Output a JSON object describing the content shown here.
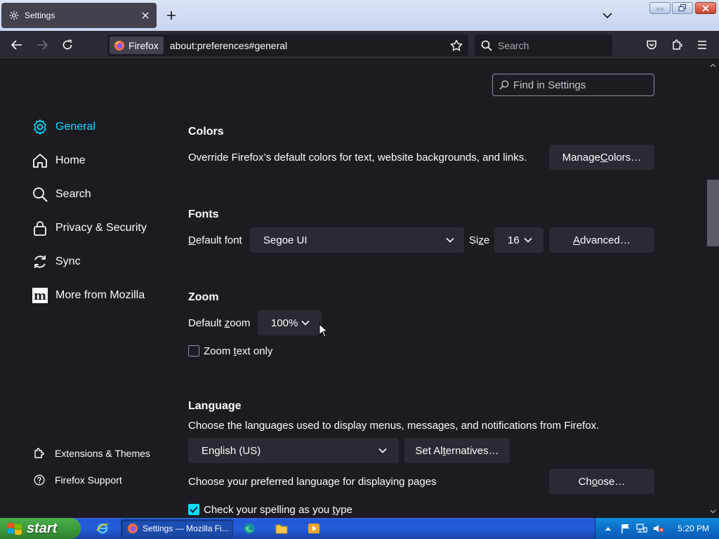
{
  "window": {
    "tab_title": "Settings",
    "url": "about:preferences#general",
    "identity_label": "Firefox",
    "search_placeholder": "Search"
  },
  "find": {
    "placeholder": "Find in Settings"
  },
  "sidebar": {
    "items": [
      {
        "label": "General",
        "icon": "gear-icon",
        "active": true
      },
      {
        "label": "Home",
        "icon": "home-icon"
      },
      {
        "label": "Search",
        "icon": "search-icon"
      },
      {
        "label": "Privacy & Security",
        "icon": "lock-icon"
      },
      {
        "label": "Sync",
        "icon": "sync-icon"
      },
      {
        "label": "More from Mozilla",
        "icon": "mozilla-icon"
      }
    ],
    "footer": [
      {
        "label": "Extensions & Themes",
        "icon": "puzzle-icon"
      },
      {
        "label": "Firefox Support",
        "icon": "help-icon"
      }
    ]
  },
  "colors": {
    "heading": "Colors",
    "description": "Override Firefox’s default colors for text, website backgrounds, and links.",
    "manage_pre": "Manage ",
    "manage_key": "C",
    "manage_post": "olors…"
  },
  "fonts": {
    "heading": "Fonts",
    "default_key": "D",
    "default_rest": "efault font",
    "default_value": "Segoe UI",
    "size_key": "z",
    "size_pre": "Si",
    "size_post": "e",
    "size_value": "16",
    "advanced_key": "A",
    "advanced_rest": "dvanced…"
  },
  "zoom": {
    "heading": "Zoom",
    "default_pre": "Default ",
    "default_key": "z",
    "default_post": "oom",
    "value": "100%",
    "text_only_pre": "Zoom ",
    "text_only_key": "t",
    "text_only_post": "ext only",
    "text_only_checked": false
  },
  "language": {
    "heading": "Language",
    "description": "Choose the languages used to display menus, messages, and notifications from Firefox.",
    "value": "English (US)",
    "alt_pre": "Set Al",
    "alt_key": "t",
    "alt_post": "ernatives…",
    "pages_description": "Choose your preferred language for displaying pages",
    "choose_pre": "Ch",
    "choose_key": "o",
    "choose_post": "ose…",
    "spell_pre": "Check your spelling as you ",
    "spell_key": "t",
    "spell_post": "ype",
    "spell_checked": true
  },
  "taskbar": {
    "start_label": "start",
    "task_label": "Settings — Mozilla Fi...",
    "clock": "5:20 PM"
  },
  "accent": "#00ddff"
}
